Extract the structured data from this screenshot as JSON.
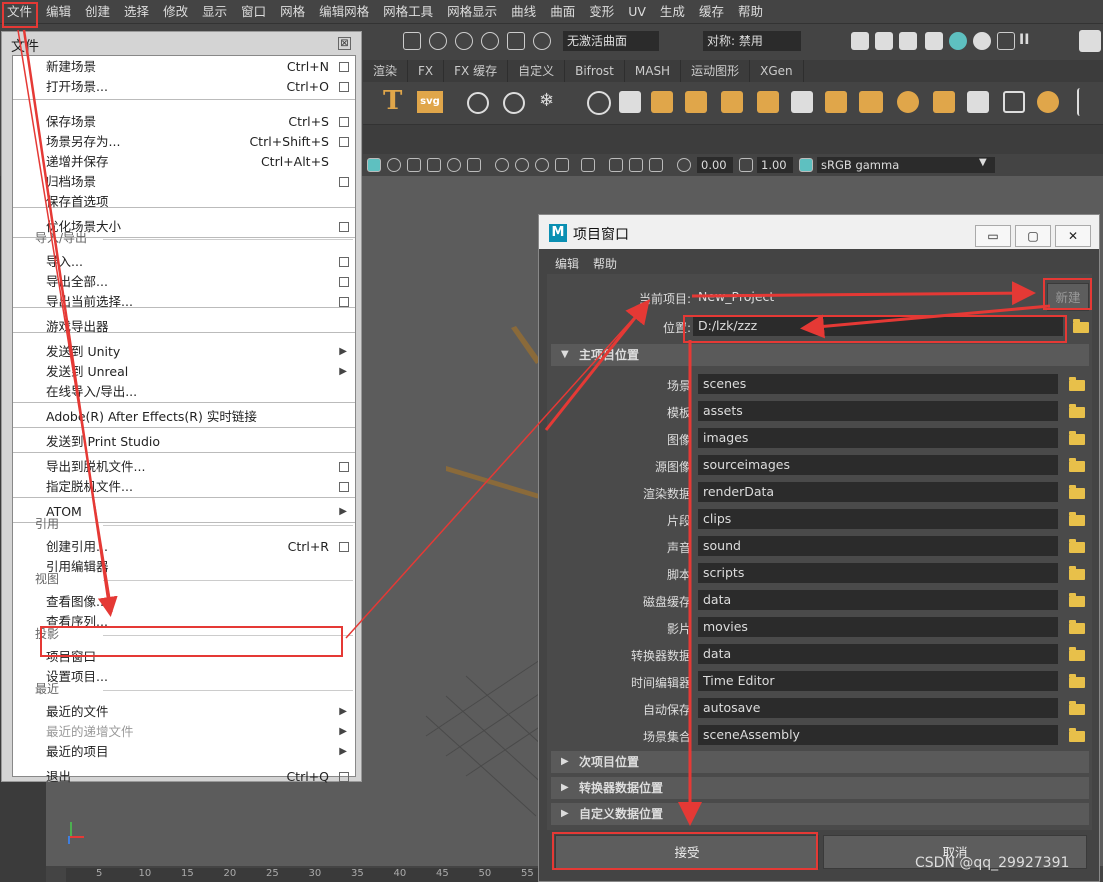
{
  "menubar": {
    "items": [
      "文件",
      "编辑",
      "创建",
      "选择",
      "修改",
      "显示",
      "窗口",
      "网格",
      "编辑网格",
      "网格工具",
      "网格显示",
      "曲线",
      "曲面",
      "变形",
      "UV",
      "生成",
      "缓存",
      "帮助"
    ]
  },
  "toolbar1": {
    "surface_field": "无激活曲面",
    "symmetry_field": "对称: 禁用"
  },
  "toolbar2": {
    "tabs": [
      "渲染",
      "FX",
      "FX 缓存",
      "自定义",
      "Bifrost",
      "MASH",
      "运动图形",
      "XGen"
    ]
  },
  "toolbar4": {
    "value_a": "0.00",
    "value_b": "1.00",
    "color_space": "sRGB gamma"
  },
  "ruler": {
    "ticks": [
      "5",
      "10",
      "15",
      "20",
      "25",
      "30",
      "35",
      "40",
      "45",
      "50",
      "55"
    ]
  },
  "file_menu": {
    "title": "文件",
    "close_glyph": "⊠",
    "rows": [
      {
        "label": "新建场景",
        "shortcut": "Ctrl+N",
        "box": true
      },
      {
        "label": "打开场景...",
        "shortcut": "Ctrl+O",
        "box": true
      },
      {
        "label": "保存场景",
        "shortcut": "Ctrl+S",
        "box": true
      },
      {
        "label": "场景另存为...",
        "shortcut": "Ctrl+Shift+S",
        "box": true
      },
      {
        "label": "递增并保存",
        "shortcut": "Ctrl+Alt+S",
        "box": false
      },
      {
        "label": "归档场景",
        "shortcut": "",
        "box": true
      },
      {
        "label": "保存首选项",
        "shortcut": "",
        "box": false
      },
      {
        "label": "优化场景大小",
        "shortcut": "",
        "box": true
      },
      {
        "label": "导入...",
        "shortcut": "",
        "box": true
      },
      {
        "label": "导出全部...",
        "shortcut": "",
        "box": true
      },
      {
        "label": "导出当前选择...",
        "shortcut": "",
        "box": true
      },
      {
        "label": "游戏导出器",
        "shortcut": "",
        "box": false
      },
      {
        "label": "发送到 Unity",
        "shortcut": "",
        "arrow": true
      },
      {
        "label": "发送到 Unreal",
        "shortcut": "",
        "arrow": true
      },
      {
        "label": "在线导入/导出...",
        "shortcut": "",
        "box": false
      },
      {
        "label": "Adobe(R) After Effects(R) 实时链接",
        "shortcut": "",
        "box": false
      },
      {
        "label": "发送到 Print Studio",
        "shortcut": "",
        "box": false
      },
      {
        "label": "导出到脱机文件...",
        "shortcut": "",
        "box": true
      },
      {
        "label": "指定脱机文件...",
        "shortcut": "",
        "box": true
      },
      {
        "label": "ATOM",
        "shortcut": "",
        "arrow": true
      },
      {
        "label": "创建引用...",
        "shortcut": "Ctrl+R",
        "box": true
      },
      {
        "label": "引用编辑器",
        "shortcut": "",
        "box": false
      },
      {
        "label": "查看图像...",
        "shortcut": "",
        "box": false
      },
      {
        "label": "查看序列...",
        "shortcut": "",
        "box": false
      },
      {
        "label": "项目窗口",
        "shortcut": "",
        "box": false
      },
      {
        "label": "设置项目...",
        "shortcut": "",
        "box": false
      },
      {
        "label": "最近的文件",
        "shortcut": "",
        "arrow": true
      },
      {
        "label": "最近的递增文件",
        "shortcut": "",
        "arrow": true,
        "disabled": true
      },
      {
        "label": "最近的项目",
        "shortcut": "",
        "arrow": true
      },
      {
        "label": "退出",
        "shortcut": "Ctrl+Q",
        "box": true
      }
    ],
    "sections": [
      "导入/导出",
      "引用",
      "视图",
      "投影",
      "最近"
    ]
  },
  "project_window": {
    "title": "项目窗口",
    "logo": "M",
    "menu": [
      "编辑",
      "帮助"
    ],
    "win_buttons": [
      "▭",
      "▢",
      "✕"
    ],
    "current_project_label": "当前项目:",
    "current_project_value": "New_Project",
    "new_button": "新建",
    "location_label": "位置:",
    "location_value": "D:/lzk/zzz",
    "main_section": "主项目位置",
    "paths": [
      {
        "label": "场景",
        "value": "scenes"
      },
      {
        "label": "模板",
        "value": "assets"
      },
      {
        "label": "图像",
        "value": "images"
      },
      {
        "label": "源图像",
        "value": "sourceimages"
      },
      {
        "label": "渲染数据",
        "value": "renderData"
      },
      {
        "label": "片段",
        "value": "clips"
      },
      {
        "label": "声音",
        "value": "sound"
      },
      {
        "label": "脚本",
        "value": "scripts"
      },
      {
        "label": "磁盘缓存",
        "value": "data"
      },
      {
        "label": "影片",
        "value": "movies"
      },
      {
        "label": "转换器数据",
        "value": "data"
      },
      {
        "label": "时间编辑器",
        "value": "Time Editor"
      },
      {
        "label": "自动保存",
        "value": "autosave"
      },
      {
        "label": "场景集合",
        "value": "sceneAssembly"
      }
    ],
    "collapsed_sections": [
      "次项目位置",
      "转换器数据位置",
      "自定义数据位置"
    ],
    "accept_button": "接受",
    "cancel_button": "取消"
  },
  "watermark": "CSDN @qq_29927391",
  "colors": {
    "annotation_red": "#e53935",
    "folder": "#e8c04a"
  }
}
